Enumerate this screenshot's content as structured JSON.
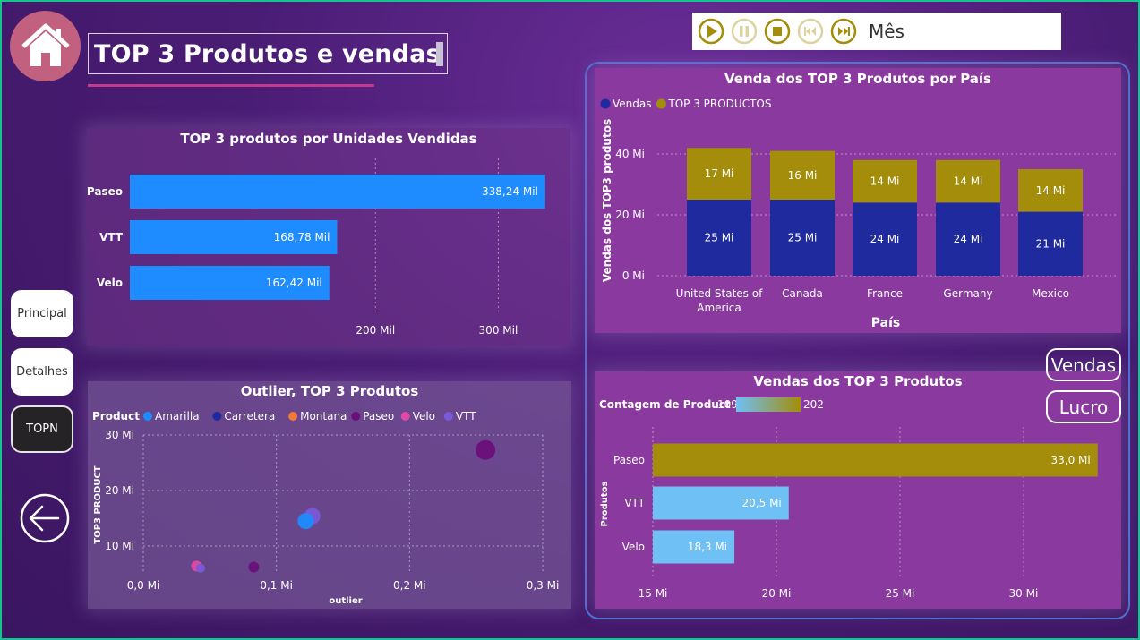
{
  "header": {
    "title": "TOP 3 Produtos e vendas",
    "home_icon": "home-icon"
  },
  "player": {
    "label": "Mês",
    "controls": [
      "play-icon",
      "pause-icon",
      "stop-icon",
      "skip-back-icon",
      "skip-forward-icon"
    ]
  },
  "nav": {
    "items": [
      {
        "label": "Principal",
        "active": false
      },
      {
        "label": "Detalhes",
        "active": false
      },
      {
        "label": "TOPN",
        "active": true
      }
    ],
    "back_icon": "arrow-left-icon"
  },
  "toggles": {
    "vendas": "Vendas",
    "lucro": "Lucro"
  },
  "colors": {
    "accent_bar": "#1e8cff",
    "vendas": "#1f2a9e",
    "top3": "#a38d0a",
    "panel_bg": "#8a3a9e",
    "frame": "#14c38e"
  },
  "chart_data": [
    {
      "id": "units",
      "type": "bar",
      "orientation": "horizontal",
      "title": "TOP 3 produtos por Unidades Vendidas",
      "categories": [
        "Paseo",
        "VTT",
        "Velo"
      ],
      "values": [
        338240,
        168780,
        162420
      ],
      "value_labels": [
        "338,24 Mil",
        "168,78 Mil",
        "162,42 Mil"
      ],
      "x_ticks": [
        {
          "value": 200000,
          "label": "200 Mil"
        },
        {
          "value": 300000,
          "label": "300 Mil"
        }
      ],
      "xlim": [
        0,
        350000
      ],
      "grid": true
    },
    {
      "id": "outlier",
      "type": "scatter",
      "title": "Outlier, TOP 3 Produtos",
      "legend_title": "Product",
      "legend": [
        {
          "name": "Amarilla",
          "color": "#1e8cff"
        },
        {
          "name": "Carretera",
          "color": "#1f2a9e"
        },
        {
          "name": "Montana",
          "color": "#f07a3a"
        },
        {
          "name": "Paseo",
          "color": "#6a0f7a"
        },
        {
          "name": "Velo",
          "color": "#e04aa6"
        },
        {
          "name": "VTT",
          "color": "#7a5ad8"
        }
      ],
      "xlabel": "outlier",
      "ylabel": "TOP3 PRODUCT",
      "xlim": [
        0,
        0.3
      ],
      "ylim": [
        5,
        30
      ],
      "x_ticks": [
        {
          "value": 0,
          "label": "0,0 Mi"
        },
        {
          "value": 0.1,
          "label": "0,1 Mi"
        },
        {
          "value": 0.2,
          "label": "0,2 Mi"
        },
        {
          "value": 0.3,
          "label": "0,3 Mi"
        }
      ],
      "y_ticks": [
        {
          "value": 10,
          "label": "10 Mi"
        },
        {
          "value": 20,
          "label": "20 Mi"
        },
        {
          "value": 30,
          "label": "30 Mi"
        }
      ],
      "points": [
        {
          "name": "Paseo",
          "x": 0.257,
          "y": 27.3,
          "r": 11,
          "color": "#6a0f7a"
        },
        {
          "name": "VTT",
          "x": 0.127,
          "y": 15.4,
          "r": 9,
          "color": "#7a5ad8"
        },
        {
          "name": "Amarilla",
          "x": 0.122,
          "y": 14.5,
          "r": 9,
          "color": "#1e8cff"
        },
        {
          "name": "Velo",
          "x": 0.04,
          "y": 6.4,
          "r": 6,
          "color": "#e04aa6"
        },
        {
          "name": "VTT",
          "x": 0.043,
          "y": 6.0,
          "r": 5,
          "color": "#7a5ad8"
        },
        {
          "name": "Paseo",
          "x": 0.083,
          "y": 6.2,
          "r": 6,
          "color": "#6a0f7a"
        }
      ],
      "grid": true
    },
    {
      "id": "country",
      "type": "bar",
      "stacked": true,
      "title": "Venda dos TOP 3 Produtos por País",
      "xlabel": "País",
      "ylabel": "Vendas dos TOP3 produtos",
      "categories": [
        "United States of America",
        "Canada",
        "France",
        "Germany",
        "Mexico"
      ],
      "category_lines": [
        [
          "United States of",
          "America"
        ],
        [
          "Canada"
        ],
        [
          "France"
        ],
        [
          "Germany"
        ],
        [
          "Mexico"
        ]
      ],
      "series": [
        {
          "name": "Vendas",
          "color": "#1f2a9e",
          "values": [
            25,
            25,
            24,
            24,
            21
          ],
          "labels": [
            "25 Mi",
            "25 Mi",
            "24 Mi",
            "24 Mi",
            "21 Mi"
          ]
        },
        {
          "name": "TOP 3 PRODUCTOS",
          "color": "#a38d0a",
          "values": [
            17,
            16,
            14,
            14,
            14
          ],
          "labels": [
            "17 Mi",
            "16 Mi",
            "14 Mi",
            "14 Mi",
            "14 Mi"
          ]
        }
      ],
      "ylim": [
        0,
        45
      ],
      "y_ticks": [
        {
          "value": 0,
          "label": "0 Mi"
        },
        {
          "value": 20,
          "label": "20 Mi"
        },
        {
          "value": 40,
          "label": "40 Mi"
        }
      ],
      "legend_position": "top-left",
      "grid": true
    },
    {
      "id": "sales",
      "type": "bar",
      "orientation": "horizontal",
      "title": "Vendas dos TOP 3 Produtos",
      "ylabel": "Produtos",
      "legend_title": "Contagem de Product",
      "gradient_min": "109",
      "gradient_max": "202",
      "gradient_colors": [
        "#6ec0f5",
        "#a38d0a"
      ],
      "categories": [
        "Paseo",
        "VTT",
        "Velo"
      ],
      "values": [
        33.0,
        20.5,
        18.3
      ],
      "value_labels": [
        "33,0 Mi",
        "20,5 Mi",
        "18,3 Mi"
      ],
      "bar_colors": [
        "#a38d0a",
        "#6ec0f5",
        "#6ec0f5"
      ],
      "xlim": [
        15,
        33.3
      ],
      "x_ticks": [
        {
          "value": 15,
          "label": "15 Mi"
        },
        {
          "value": 20,
          "label": "20 Mi"
        },
        {
          "value": 25,
          "label": "25 Mi"
        },
        {
          "value": 30,
          "label": "30 Mi"
        }
      ],
      "grid": true
    }
  ]
}
